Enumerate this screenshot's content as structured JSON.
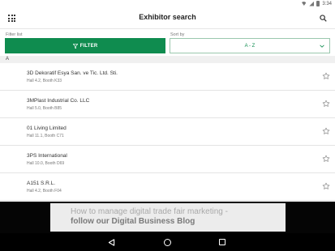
{
  "status_bar": {
    "time": "3:34"
  },
  "app_bar": {
    "title": "Exhibitor search"
  },
  "filter": {
    "label": "Filter list",
    "button_label": "FILTER"
  },
  "sort": {
    "label": "Sort by",
    "selected": "A - Z"
  },
  "section": {
    "header": "A"
  },
  "exhibitors": [
    {
      "name": "3D Dekoratif Esya San. ve Tic. Ltd. Sti.",
      "location": "Hall 4.2, Booth K33"
    },
    {
      "name": "3MPlast Industrial Co. LLC",
      "location": "Hall 5.0, Booth B85"
    },
    {
      "name": "01 Living Limited",
      "location": "Hall 11.1, Booth C71"
    },
    {
      "name": "3PS International",
      "location": "Hall 10.0, Booth D69"
    },
    {
      "name": "A151 S.R.L.",
      "location": "Hall 4.2, Booth F04"
    }
  ],
  "banner": {
    "line1": "How to manage digital trade fair marketing -",
    "line2_prefix": "follow our ",
    "line2_bold": "Digital Business Blog"
  },
  "colors": {
    "accent": "#0f8c4f",
    "nav_bar": "#000000"
  },
  "icons": {
    "menu": "grid-icon",
    "search": "search-icon",
    "filter": "funnel-icon",
    "sort": "chevron-down-icon",
    "favorite": "star-outline-icon"
  }
}
